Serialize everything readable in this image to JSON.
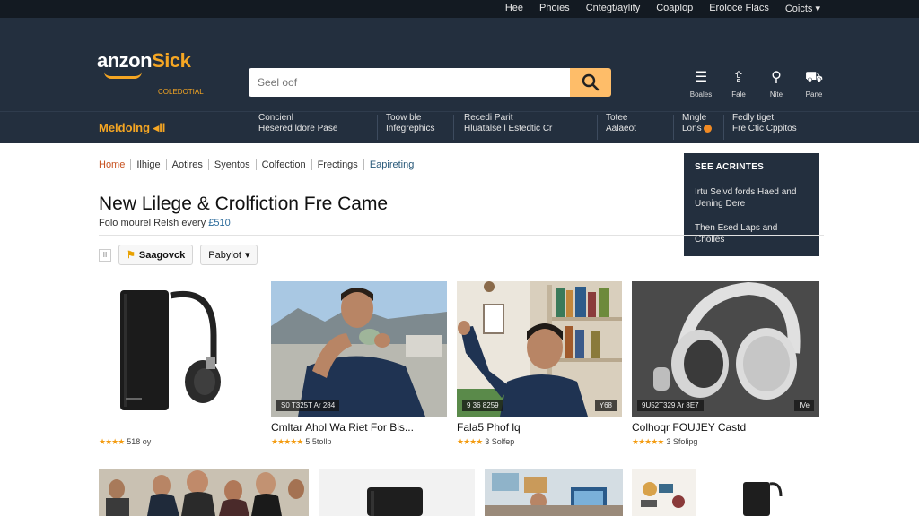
{
  "topbar": {
    "links": [
      "Hee",
      "Phoies",
      "Cntegt/aylity",
      "Coaplop",
      "Eroloce Flacs",
      "Coicts"
    ]
  },
  "header": {
    "logo_main": "anzon",
    "logo_accent": "Sick",
    "logo_sub": "COLEDOTIAL",
    "search_placeholder": "Seel oof",
    "icons": [
      {
        "icon": "menu-icon",
        "glyph": "☰",
        "label": "Boales"
      },
      {
        "icon": "share-icon",
        "glyph": "⇪",
        "label": "Fale"
      },
      {
        "icon": "location-icon",
        "glyph": "⚲",
        "label": "Nite"
      },
      {
        "icon": "cart-icon",
        "glyph": "⛟",
        "label": "Pane"
      }
    ]
  },
  "nav": {
    "department": "Meldoing",
    "department_suffix": "◂ll",
    "items": [
      {
        "l1": "Concienl",
        "l2": "Hesered ldore Pase"
      },
      {
        "l1": "Toow ble",
        "l2": "Infegrephics"
      },
      {
        "l1": "Recedi Parit",
        "l2": "Hluatalse l Estedtic Cr"
      },
      {
        "l1": "Totee",
        "l2": "Aalaeot"
      },
      {
        "l1": "Mngle",
        "l2": "Lons"
      },
      {
        "l1": "Fedly tiget",
        "l2": "Fre Ctic Cppitos"
      }
    ]
  },
  "breadcrumb": [
    "Home",
    "Ilhige",
    "Aotires",
    "Syentos",
    "Colfection",
    "Frectings",
    "Eapireting"
  ],
  "panel": {
    "heading": "SEE ACRINTES",
    "lines": [
      "Irtu Selvd fords Haed and Uening Dere",
      "Then Esed Laps and Cholles"
    ]
  },
  "page": {
    "title": "New Lilege & Crolfiction Fre Came",
    "subtitle_prefix": "Folo mourel Relsh every ",
    "subtitle_price": "£510"
  },
  "filters": {
    "checkbox": "II",
    "button1_tag": "⚑",
    "button1": "Saagovck",
    "button2": "Pabylot",
    "button2_caret": "▾"
  },
  "products": [
    {
      "name": "",
      "overlay_left": "",
      "overlay_right": "",
      "stars": "★★★★",
      "rating_text": "518 oy"
    },
    {
      "name": "Cmltar Ahol Wa Riet For Bis...",
      "overlay_left": "S0 T325T   Ar 284",
      "overlay_right": "",
      "stars": "★★★★★",
      "rating_text": "5 5tollp"
    },
    {
      "name": "Fala5 Phof lq",
      "overlay_left": "9 36 8259",
      "overlay_right": "Y68",
      "stars": "★★★★",
      "rating_text": "3 Solfep"
    },
    {
      "name": "Colhoqr FOUJEY Castd",
      "overlay_left": "9U52T329   Ar 8E7",
      "overlay_right": "IVe",
      "stars": "★★★★★",
      "rating_text": "3 Sfolipg"
    }
  ],
  "colors": {
    "nav_dark": "#232f3e",
    "top_dark": "#131a22",
    "accent": "#f5a623",
    "search_button": "#febd69",
    "star": "#f39c12",
    "link_red": "#c7511f"
  }
}
